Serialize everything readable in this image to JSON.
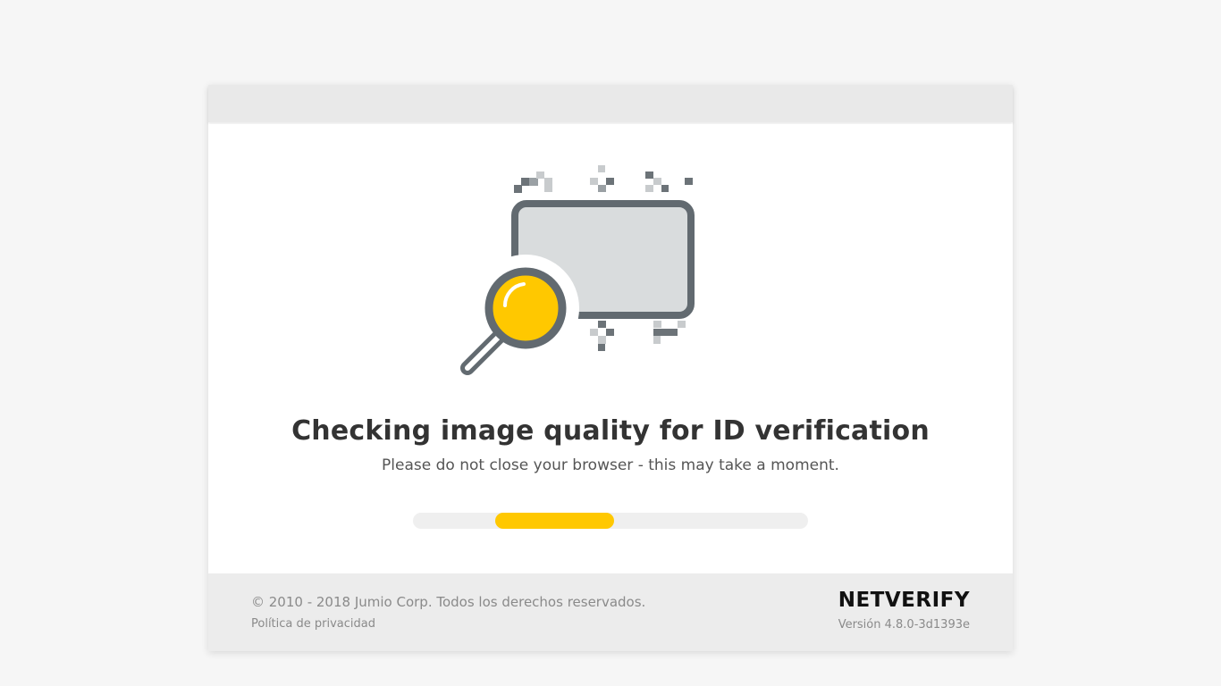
{
  "main": {
    "title": "Checking image quality for ID verification",
    "subtitle": "Please do not close your browser - this may take a moment.",
    "progress_fraction": 0.3,
    "illustration_icon": "id-card-magnifier-icon"
  },
  "footer": {
    "copyright": "© 2010 - 2018 Jumio Corp. Todos los derechos reservados.",
    "privacy_link": "Política de privacidad",
    "brand": "NETVERIFY",
    "version": "Versión 4.8.0-3d1393e"
  },
  "colors": {
    "accent": "#ffc800",
    "icon_stroke": "#626a70",
    "card_fill": "#d9dcdd",
    "background": "#f6f6f6",
    "title_text": "#333333"
  }
}
